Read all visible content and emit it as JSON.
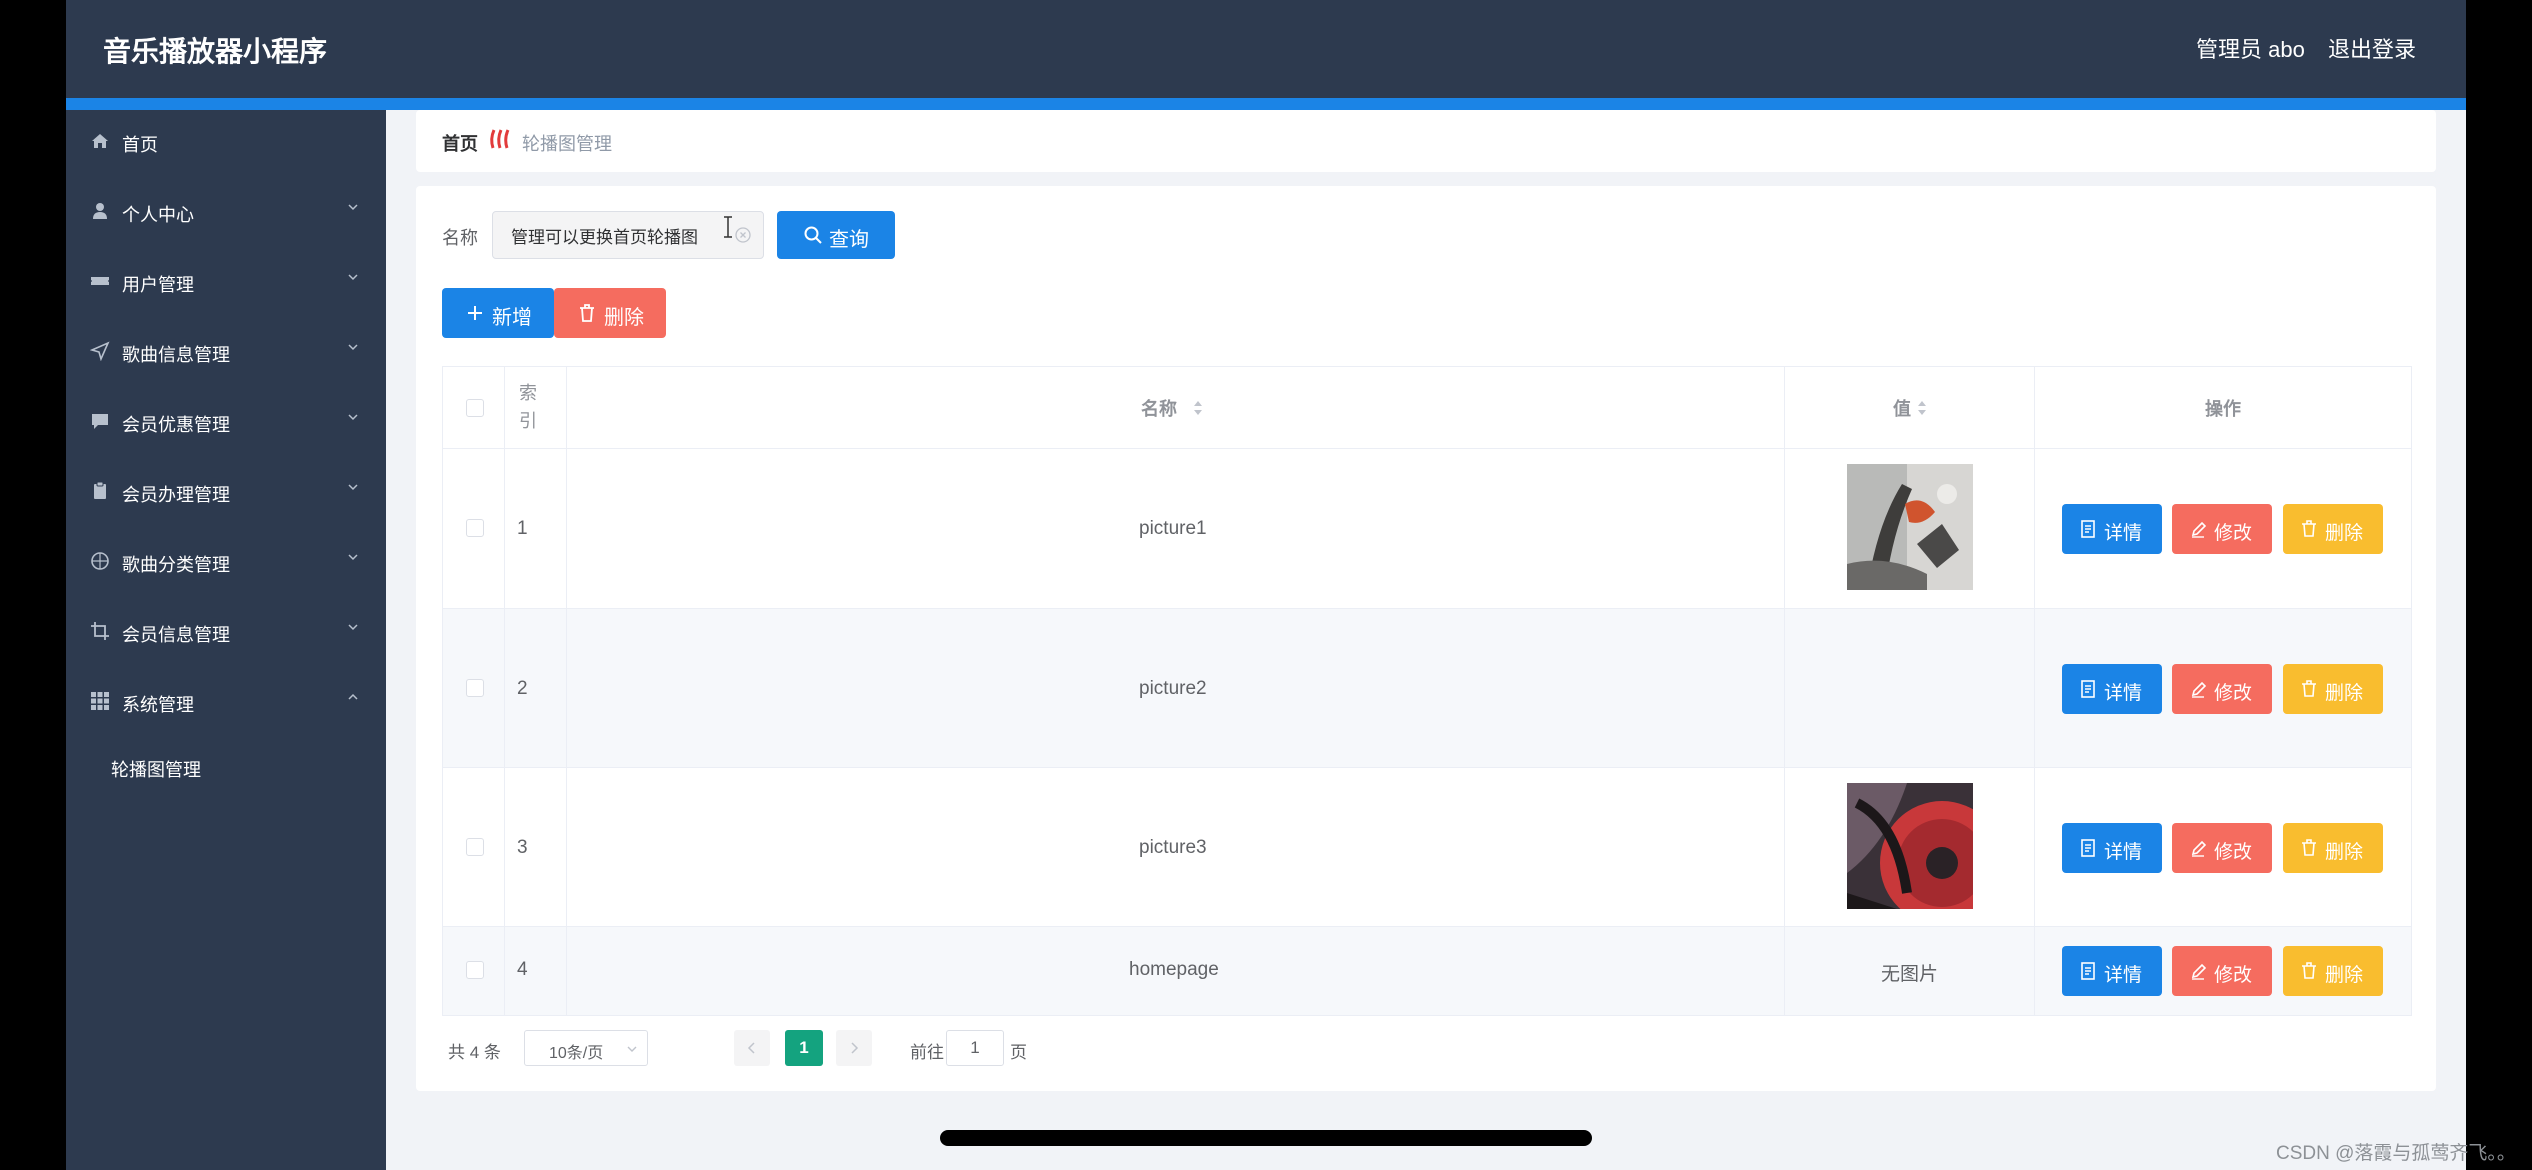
{
  "header": {
    "title": "音乐播放器小程序",
    "user": "管理员 abo",
    "logout": "退出登录"
  },
  "sidebar": {
    "items": [
      {
        "label": "首页",
        "icon": "home-icon"
      },
      {
        "label": "个人中心",
        "icon": "user-icon",
        "expandable": true
      },
      {
        "label": "用户管理",
        "icon": "ticket-icon",
        "expandable": true
      },
      {
        "label": "歌曲信息管理",
        "icon": "send-icon",
        "expandable": true
      },
      {
        "label": "会员优惠管理",
        "icon": "chat-icon",
        "expandable": true
      },
      {
        "label": "会员办理管理",
        "icon": "clipboard-icon",
        "expandable": true
      },
      {
        "label": "歌曲分类管理",
        "icon": "compass-icon",
        "expandable": true
      },
      {
        "label": "会员信息管理",
        "icon": "crop-icon",
        "expandable": true
      },
      {
        "label": "系统管理",
        "icon": "grid-icon",
        "expanded": true
      }
    ],
    "subitems": [
      {
        "label": "轮播图管理"
      }
    ]
  },
  "breadcrumb": {
    "home": "首页",
    "current": "轮播图管理"
  },
  "search": {
    "label": "名称",
    "value": "管理可以更换首页轮播图",
    "button": "查询"
  },
  "actions": {
    "add": "新增",
    "delete": "删除"
  },
  "table": {
    "headers": {
      "index": "索\n引",
      "name": "名称",
      "value": "值",
      "ops": "操作"
    },
    "rows": [
      {
        "index": "1",
        "name": "picture1",
        "value_type": "image",
        "image_theme": "abstract-art"
      },
      {
        "index": "2",
        "name": "picture2",
        "value_type": "empty"
      },
      {
        "index": "3",
        "name": "picture3",
        "value_type": "image",
        "image_theme": "vinyl-record"
      },
      {
        "index": "4",
        "name": "homepage",
        "value_type": "text",
        "value_text": "无图片"
      }
    ],
    "row_actions": {
      "detail": "详情",
      "edit": "修改",
      "delete": "删除"
    }
  },
  "pagination": {
    "total": "共 4 条",
    "page_size": "10条/页",
    "current_page": "1",
    "goto_label": "前往",
    "goto_value": "1",
    "goto_unit": "页"
  },
  "watermark": "CSDN @落霞与孤莺齐飞。。",
  "colors": {
    "header_bg": "#2d3a4f",
    "primary": "#1b84e6",
    "danger": "#f56c5f",
    "warning": "#f9bd2f",
    "active_page": "#14a37f"
  }
}
